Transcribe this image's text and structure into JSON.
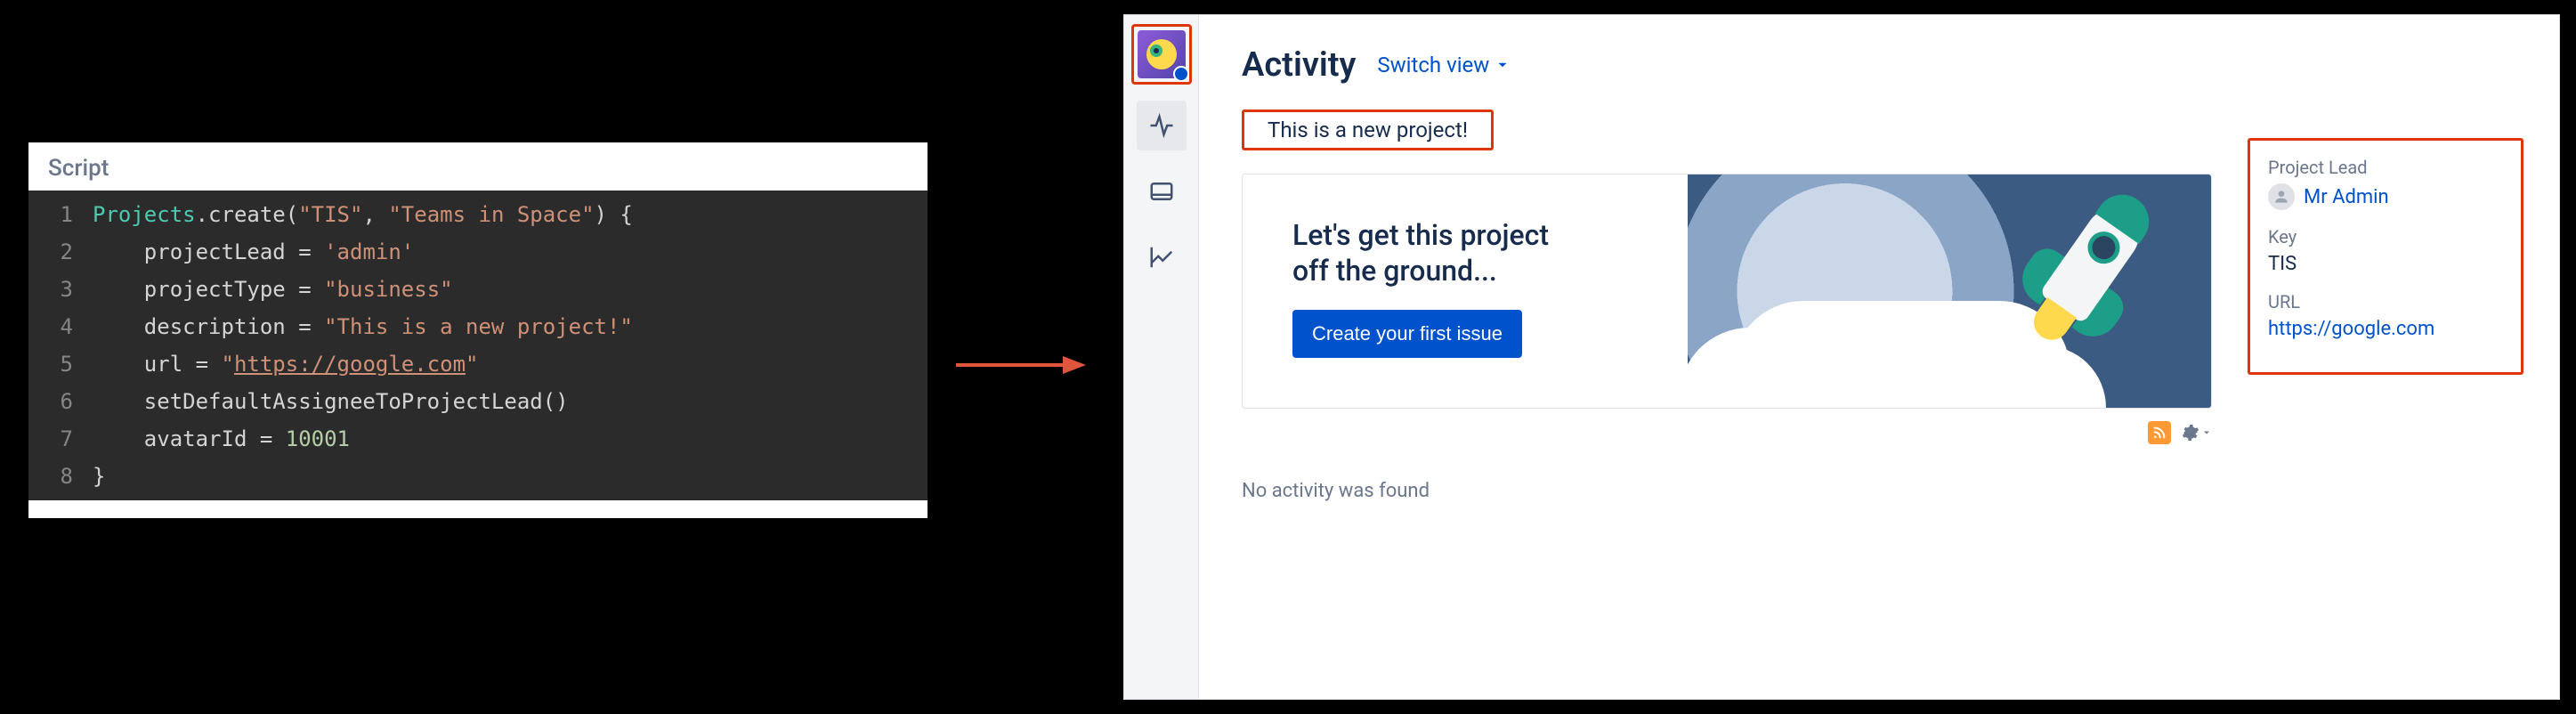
{
  "code_panel": {
    "title": "Script",
    "lines": [
      {
        "n": 1,
        "tokens": [
          {
            "t": "Projects",
            "c": "tok-type"
          },
          {
            "t": ".create(",
            "c": "tok-method"
          },
          {
            "t": "\"TIS\"",
            "c": "tok-string"
          },
          {
            "t": ", ",
            "c": "tok-punct"
          },
          {
            "t": "\"Teams in Space\"",
            "c": "tok-string"
          },
          {
            "t": ") {",
            "c": "tok-punct"
          }
        ]
      },
      {
        "n": 2,
        "tokens": [
          {
            "t": "    projectLead = ",
            "c": "tok-method"
          },
          {
            "t": "'admin'",
            "c": "tok-string"
          }
        ]
      },
      {
        "n": 3,
        "tokens": [
          {
            "t": "    projectType = ",
            "c": "tok-method"
          },
          {
            "t": "\"business\"",
            "c": "tok-string"
          }
        ]
      },
      {
        "n": 4,
        "tokens": [
          {
            "t": "    description = ",
            "c": "tok-method"
          },
          {
            "t": "\"This is a new project!\"",
            "c": "tok-string"
          }
        ]
      },
      {
        "n": 5,
        "tokens": [
          {
            "t": "    url = ",
            "c": "tok-method"
          },
          {
            "t": "\"",
            "c": "tok-string"
          },
          {
            "t": "https://google.com",
            "c": "tok-url"
          },
          {
            "t": "\"",
            "c": "tok-string"
          }
        ]
      },
      {
        "n": 6,
        "tokens": [
          {
            "t": "    setDefaultAssigneeToProjectLead()",
            "c": "tok-method"
          }
        ]
      },
      {
        "n": 7,
        "tokens": [
          {
            "t": "    avatarId = ",
            "c": "tok-method"
          },
          {
            "t": "10001",
            "c": "tok-number"
          }
        ]
      },
      {
        "n": 8,
        "tokens": [
          {
            "t": "}",
            "c": "tok-punct"
          }
        ]
      }
    ]
  },
  "jira": {
    "title": "Activity",
    "switch_view": "Switch view",
    "description": "This is a new project!",
    "hero": {
      "line1": "Let's get this project",
      "line2": "off the ground...",
      "button": "Create your first issue"
    },
    "no_activity": "No activity was found",
    "info": {
      "lead_label": "Project Lead",
      "lead_name": "Mr Admin",
      "key_label": "Key",
      "key_value": "TIS",
      "url_label": "URL",
      "url_value": "https://google.com"
    }
  }
}
